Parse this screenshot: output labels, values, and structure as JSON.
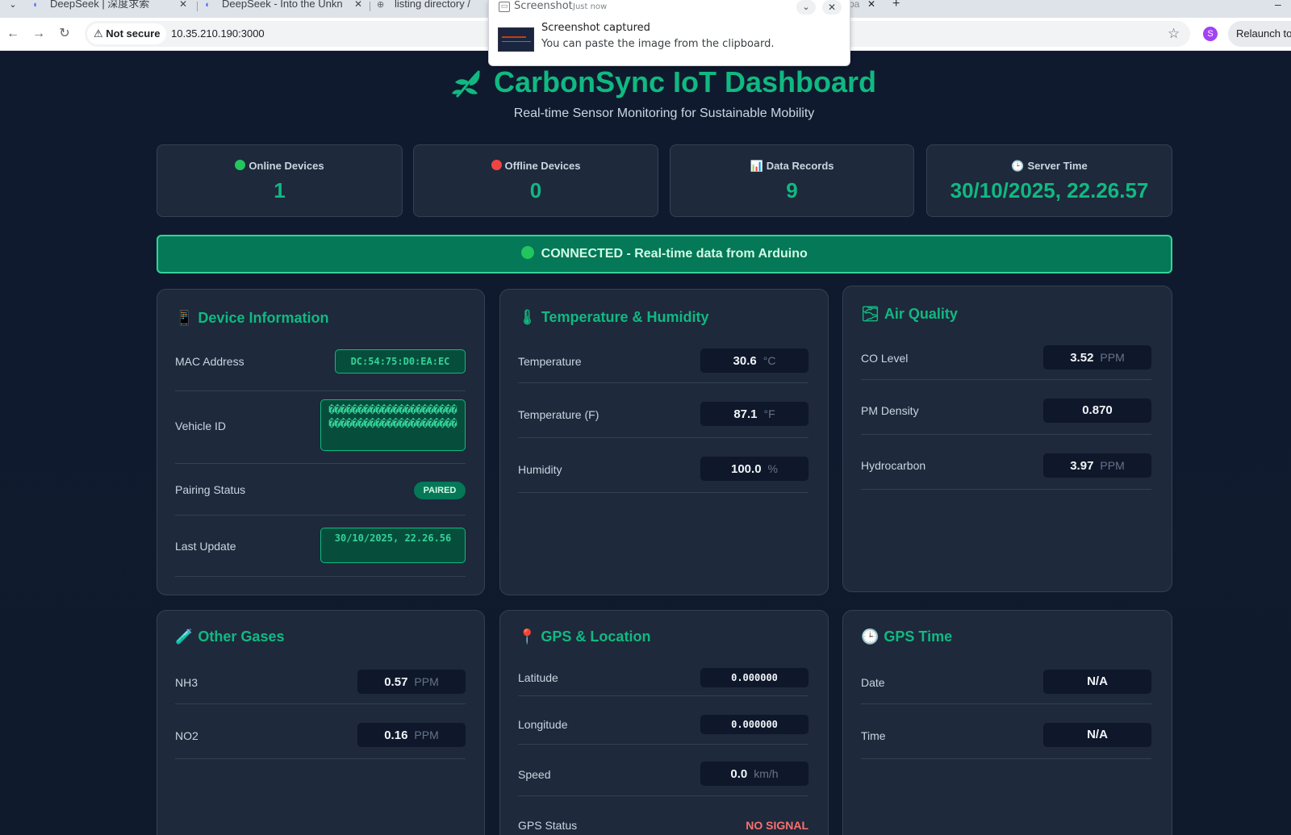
{
  "browser": {
    "tabs": [
      {
        "title": "DeepSeek | 深度求索"
      },
      {
        "title": "DeepSeek - Into the Unkn"
      },
      {
        "title": "listing directory /"
      }
    ],
    "partial_tab_text": "pa",
    "not_secure_label": "Not secure",
    "url": "10.35.210.190:3000",
    "profile_initial": "S",
    "relaunch_label": "Relaunch to u"
  },
  "notification": {
    "app": "Screenshot",
    "time": "Just now",
    "title": "Screenshot captured",
    "body": "You can paste the image from the clipboard."
  },
  "header": {
    "title": "CarbonSync IoT Dashboard",
    "subtitle": "Real-time Sensor Monitoring for Sustainable Mobility"
  },
  "stats": {
    "online": {
      "label": "Online Devices",
      "value": "1"
    },
    "offline": {
      "label": "Offline Devices",
      "value": "0"
    },
    "records": {
      "label": "Data Records",
      "value": "9"
    },
    "server_time": {
      "label": "Server Time",
      "value": "30/10/2025, 22.26.57"
    }
  },
  "banner": {
    "text": "CONNECTED - Real-time data from Arduino"
  },
  "device": {
    "title": "Device Information",
    "mac_label": "MAC Address",
    "mac_value": "DC:54:75:D0:EA:EC",
    "vehicle_label": "Vehicle ID",
    "vehicle_value": "��������������������������������������������",
    "pairing_label": "Pairing Status",
    "pairing_value": "PAIRED",
    "last_update_label": "Last Update",
    "last_update_value": "30/10/2025, 22.26.56"
  },
  "temp": {
    "title": "Temperature & Humidity",
    "rows": [
      {
        "label": "Temperature",
        "value": "30.6",
        "unit": "°C"
      },
      {
        "label": "Temperature (F)",
        "value": "87.1",
        "unit": "°F"
      },
      {
        "label": "Humidity",
        "value": "100.0",
        "unit": "%"
      }
    ]
  },
  "air": {
    "title": "Air Quality",
    "rows": [
      {
        "label": "CO Level",
        "value": "3.52",
        "unit": "PPM"
      },
      {
        "label": "PM Density",
        "value": "0.870",
        "unit": ""
      },
      {
        "label": "Hydrocarbon",
        "value": "3.97",
        "unit": "PPM"
      }
    ]
  },
  "gases": {
    "title": "Other Gases",
    "rows": [
      {
        "label": "NH3",
        "value": "0.57",
        "unit": "PPM"
      },
      {
        "label": "NO2",
        "value": "0.16",
        "unit": "PPM"
      }
    ]
  },
  "gps": {
    "title": "GPS & Location",
    "latitude_label": "Latitude",
    "latitude_value": "0.000000",
    "longitude_label": "Longitude",
    "longitude_value": "0.000000",
    "speed_label": "Speed",
    "speed_value": "0.0",
    "speed_unit": "km/h",
    "status_label": "GPS Status",
    "status_value": "NO SIGNAL"
  },
  "gps_time": {
    "title": "GPS Time",
    "date_label": "Date",
    "date_value": "N/A",
    "time_label": "Time",
    "time_value": "N/A"
  },
  "colors": {
    "accent": "#10b981",
    "background": "#0f172a",
    "card": "#1e293b",
    "danger": "#f87171"
  }
}
